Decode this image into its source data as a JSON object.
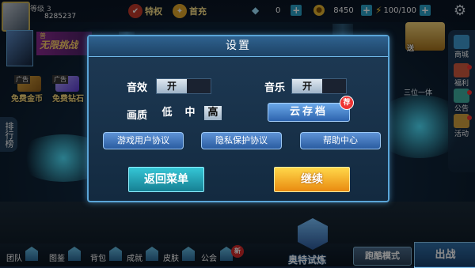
{
  "player": {
    "level": "等级 3",
    "id": "8285237"
  },
  "topbar": {
    "privilege_label": "特权",
    "first_charge_label": "首充",
    "diamonds": "0",
    "gold": "8450",
    "energy": "100/100"
  },
  "left": {
    "banner_top": "普",
    "banner_label": "无限挑战",
    "ad_tag": "广告",
    "free_gold": "免费金币",
    "free_diamond": "免费钻石",
    "rank": "排行榜"
  },
  "right": {
    "promo_label": "送",
    "shop": "商城",
    "welfare": "福利",
    "notice": "公告",
    "events": "活动",
    "rank_tag": "三位一体"
  },
  "bottom": {
    "items": [
      "团队",
      "图鉴",
      "背包",
      "成就",
      "皮肤",
      "公会"
    ],
    "new_badge": "新",
    "trial": "奥特试炼",
    "run_mode": "跑酷模式",
    "battle": "出战"
  },
  "dialog": {
    "title": "设置",
    "sound_label": "音效",
    "sound_value": "开",
    "music_label": "音乐",
    "music_value": "开",
    "quality_label": "画质",
    "quality_options": [
      "低",
      "中",
      "高"
    ],
    "quality_selected": "高",
    "cloud_save": "云存档",
    "cloud_badge": "荐",
    "user_agreement": "游戏用户协议",
    "privacy_policy": "隐私保护协议",
    "help_center": "帮助中心",
    "return_menu": "返回菜单",
    "continue": "继续"
  },
  "colors": {
    "dialog_border": "#5aa5d8",
    "continue_btn": "#f5a623",
    "menu_btn": "#2aa6b8"
  }
}
